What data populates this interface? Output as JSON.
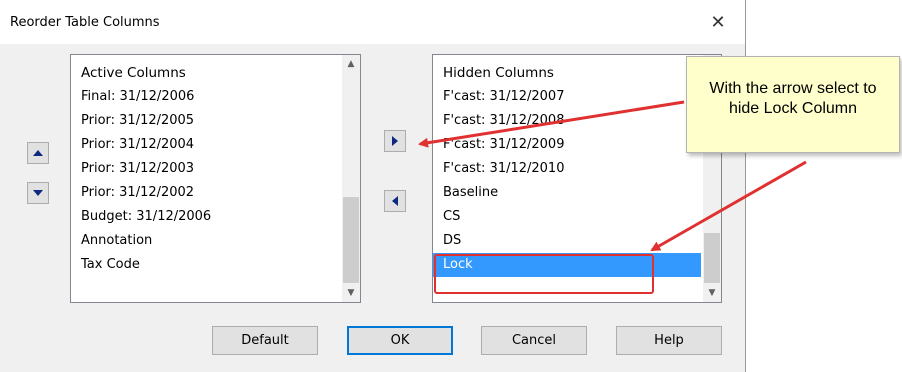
{
  "window": {
    "title": "Reorder Table Columns",
    "close_glyph": "✕"
  },
  "active_list": {
    "header": "Active Columns",
    "items": [
      "Final: 31/12/2006",
      "Prior: 31/12/2005",
      "Prior: 31/12/2004",
      "Prior: 31/12/2003",
      "Prior: 31/12/2002",
      "Budget: 31/12/2006",
      "Annotation",
      "Tax Code"
    ]
  },
  "hidden_list": {
    "header": "Hidden Columns",
    "items": [
      "F'cast: 31/12/2007",
      "F'cast: 31/12/2008",
      "F'cast: 31/12/2009",
      "F'cast: 31/12/2010",
      "Baseline",
      "CS",
      "DS",
      "Lock"
    ],
    "selected_item": "Lock"
  },
  "buttons": {
    "default": "Default",
    "ok": "OK",
    "cancel": "Cancel",
    "help": "Help"
  },
  "callout": {
    "line1": "With the arrow select to",
    "line2": "hide Lock Column"
  },
  "colors": {
    "selection": "#3399ff",
    "annotation": "#e03030",
    "callout_bg": "#ffffcc",
    "arrow_glyph": "#0d2880"
  },
  "icons": {
    "move_up": "up-triangle",
    "move_down": "down-triangle",
    "hide": "right-triangle",
    "show": "left-triangle"
  }
}
